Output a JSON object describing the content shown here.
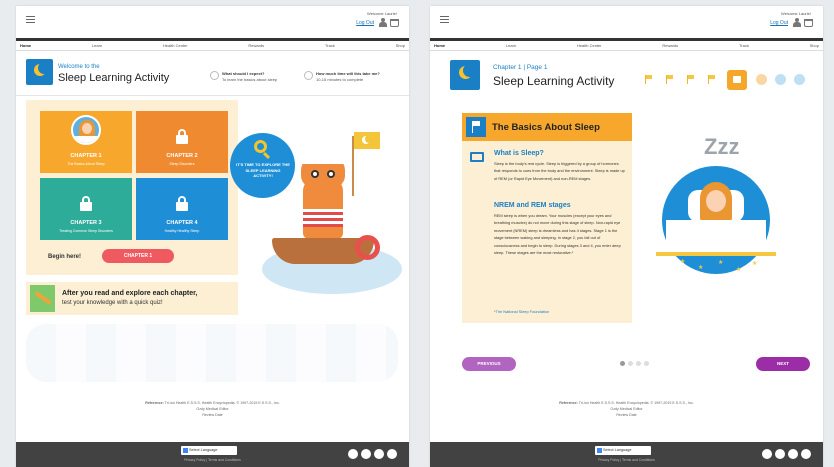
{
  "common": {
    "welcome_text": "Welcome Laurie!",
    "logout_label": "Log Out",
    "nav": [
      "Home",
      "Learn",
      "Health Center",
      "Rewards",
      "Track",
      "Shop"
    ],
    "reference_label": "Reference:",
    "reference_text": "Tri-ion Health E.S.S.S. Health Encyclopedia. © 1997-2019 E.S.S.S., Inc.",
    "editor": "Ozdy Medical Editor",
    "review": "Review Date",
    "language_label": "Select Language",
    "footer_links": "Privacy Policy | Terms and Conditions"
  },
  "panel1": {
    "header_sub": "Welcome to the",
    "header_title": "Sleep Learning Activity",
    "q1_title": "What should I expect?",
    "q1_sub": "To learn the basics about sleep",
    "q2_title": "How much time will this take me?",
    "q2_sub": "10-15 minutes to complete",
    "chapters": [
      {
        "title": "CHAPTER 1",
        "subtitle": "The Basics About Sleep",
        "color": "#f7a82c"
      },
      {
        "title": "CHAPTER 2",
        "subtitle": "Sleep Disorders",
        "color": "#f08a30"
      },
      {
        "title": "CHAPTER 3",
        "subtitle": "Treating Common Sleep Disorders",
        "color": "#2eac9a"
      },
      {
        "title": "CHAPTER 4",
        "subtitle": "Healthy Healthy Sleep",
        "color": "#1e8fd6"
      }
    ],
    "begin_label": "Begin here!",
    "begin_button": "CHAPTER 1",
    "quiz_line1": "After you read and explore each chapter,",
    "quiz_line2": "test your knowledge with a quick quiz!",
    "bubble_text": "IT'S TIME TO EXPLORE THE SLEEP LEARNING ACTIVITY!"
  },
  "panel2": {
    "header_sub": "Chapter 1 | Page 1",
    "header_title": "Sleep Learning Activity",
    "card_title": "The Basics About Sleep",
    "section1_title": "What is Sleep?",
    "section1_text": "Sleep is the body's rest cycle. Sleep is triggered by a group of hormones that responds to cues from the body and the environment. Sleep is made up of REM (or Rapid Eye Movement) and non-REM stages.",
    "section2_title": "NREM and REM stages",
    "section2_text": "REM sleep is when you dream. Your muscles (except your eyes and breathing muscles) do not move during this stage of sleep. Non-rapid eye movement (NREM) sleep is dreamless and has 4 stages. Stage 1 is the stage between waking and sleeping. In stage 2, you fall out of consciousness and begin to sleep. During stages 3 and 4, you enter deep sleep. These stages are the most restorative.*",
    "source": "*The National Sleep Foundation",
    "zzz": "Zzz",
    "prev_label": "PREVIOUS",
    "next_label": "NEXT",
    "progress": [
      "flag",
      "flag",
      "flag",
      "flag",
      "lock-current",
      "dot",
      "dot",
      "dot"
    ],
    "page_dots": 4,
    "current_page": 1
  }
}
